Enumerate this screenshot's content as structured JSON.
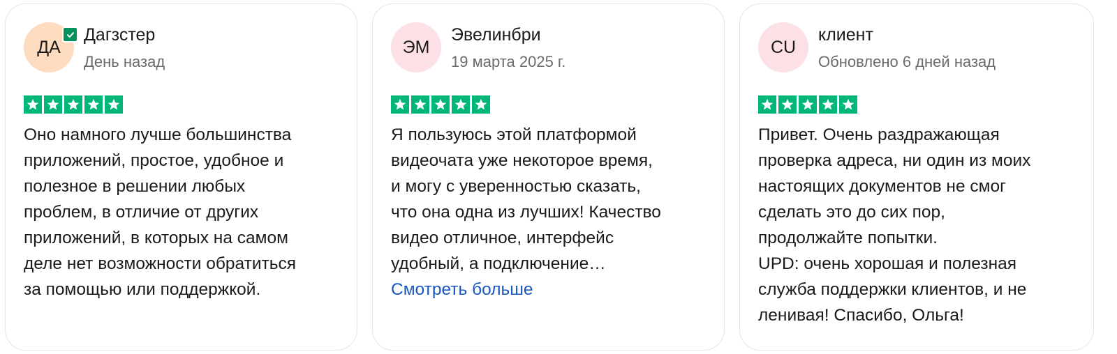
{
  "colors": {
    "star_green": "#00b67a",
    "verified_badge": "#04925c",
    "link_blue": "#1a57c2",
    "avatar_orange": "#fddcc0",
    "avatar_pink": "#fde0e5"
  },
  "reviews": [
    {
      "avatar_initials": "ДА",
      "avatar_color": "#fddcc0",
      "verified": true,
      "name": "Дагзстер",
      "date": "День назад",
      "rating": 5,
      "text": "Оно намного лучше большинства\nприложений, простое, удобное и\nполезное в решении любых\nпроблем, в отличие от других\nприложений, в которых на самом\nделе нет возможности обратиться\nза помощью или поддержкой."
    },
    {
      "avatar_initials": "ЭМ",
      "avatar_color": "#fde0e5",
      "verified": false,
      "name": "Эвелинбри",
      "date": "19 марта 2025 г.",
      "rating": 5,
      "text": "Я пользуюсь этой платформой\nвидеочата уже некоторое время,\nи могу с уверенностью сказать,\nчто она одна из лучших! Качество\nвидео отличное, интерфейс\nудобный, а подключение…",
      "more_label": "Смотреть больше"
    },
    {
      "avatar_initials": "CU",
      "avatar_color": "#fde0e5",
      "verified": false,
      "name": "клиент",
      "date": "Обновлено 6 дней назад",
      "rating": 5,
      "text": "Привет. Очень раздражающая\nпроверка адреса, ни один из моих\nнастоящих документов не смог\nсделать это до сих пор,\nпродолжайте попытки.\nUPD: очень хорошая и полезная\nслужба поддержки клиентов, и не\nленивая! Спасибо, Ольга!"
    }
  ]
}
